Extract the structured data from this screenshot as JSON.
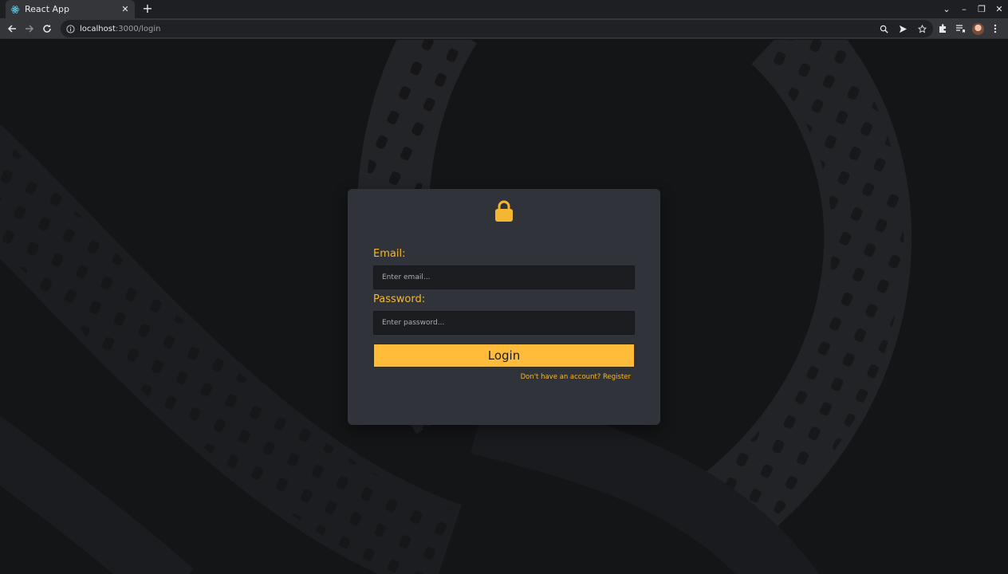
{
  "browser": {
    "tab": {
      "title": "React App",
      "favicon": "react-icon",
      "close_symbol": "✕"
    },
    "new_tab_symbol": "+",
    "window_controls": {
      "tab_search": "⌄",
      "minimize": "–",
      "restore": "❐",
      "close": "✕"
    },
    "address_bar": {
      "host": "localhost",
      "path": ":3000/login"
    },
    "icons": [
      "back-icon",
      "forward-icon",
      "reload-icon",
      "info-icon",
      "zoom-icon",
      "send-icon",
      "star-icon",
      "extensions-icon",
      "reading-list-icon",
      "profile-avatar",
      "menu-icon"
    ]
  },
  "login": {
    "email_label": "Email:",
    "email_placeholder": "Enter email...",
    "email_value": "",
    "password_label": "Password:",
    "password_placeholder": "Enter password...",
    "password_value": "",
    "submit_label": "Login",
    "register_prompt": "Don't have an account? ",
    "register_link": "Register"
  },
  "colors": {
    "accent": "#f5b731",
    "button": "#ffbc3b",
    "card": "#30343a",
    "input": "#1b1d20",
    "background": "#141516"
  }
}
